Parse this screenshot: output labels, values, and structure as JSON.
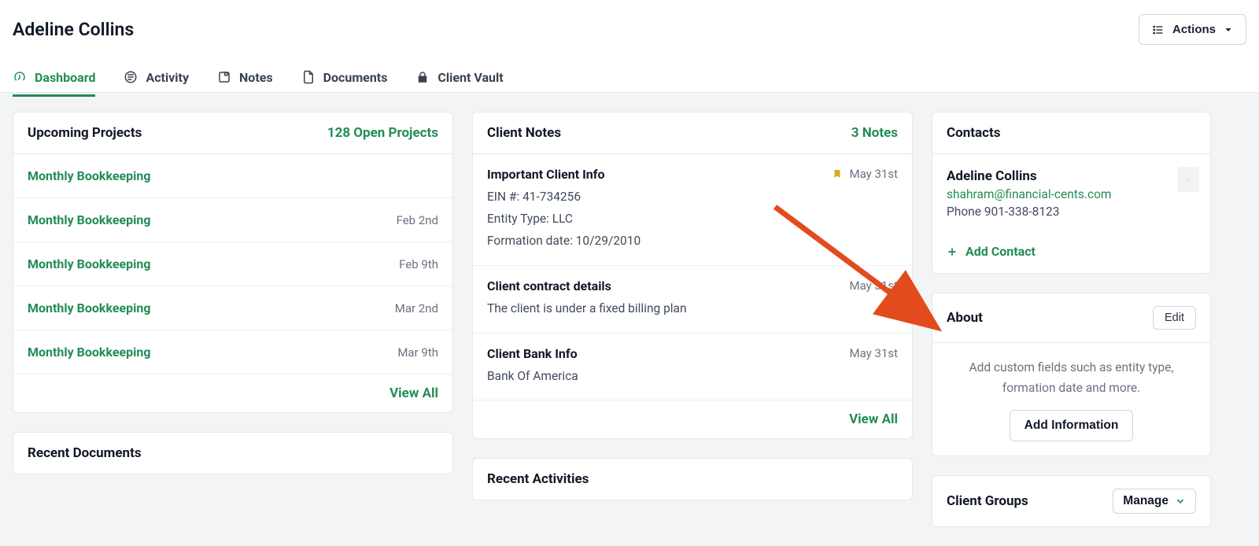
{
  "header": {
    "title": "Adeline Collins",
    "actions_label": "Actions"
  },
  "tabs": {
    "dashboard": "Dashboard",
    "activity": "Activity",
    "notes": "Notes",
    "documents": "Documents",
    "client_vault": "Client Vault"
  },
  "projects": {
    "title": "Upcoming Projects",
    "open_label": "128 Open Projects",
    "rows": [
      {
        "name": "Monthly Bookkeeping",
        "date": ""
      },
      {
        "name": "Monthly Bookkeeping",
        "date": "Feb 2nd"
      },
      {
        "name": "Monthly Bookkeeping",
        "date": "Feb 9th"
      },
      {
        "name": "Monthly Bookkeeping",
        "date": "Mar 2nd"
      },
      {
        "name": "Monthly Bookkeeping",
        "date": "Mar 9th"
      }
    ],
    "view_all": "View All"
  },
  "notes": {
    "title": "Client Notes",
    "count_label": "3 Notes",
    "items": [
      {
        "title": "Important Client Info",
        "bookmarked": true,
        "date": "May 31st",
        "lines": [
          "EIN #: 41-734256",
          "Entity Type: LLC",
          "Formation date: 10/29/2010"
        ]
      },
      {
        "title": "Client contract details",
        "bookmarked": false,
        "date": "May 31st",
        "lines": [
          "The client is under a fixed billing plan"
        ]
      },
      {
        "title": "Client Bank Info",
        "bookmarked": false,
        "date": "May 31st",
        "lines": [
          "Bank Of America"
        ]
      }
    ],
    "view_all": "View All"
  },
  "contacts": {
    "title": "Contacts",
    "name": "Adeline Collins",
    "email": "shahram@financial-cents.com",
    "phone": "Phone 901-338-8123",
    "add_contact": "Add Contact"
  },
  "about": {
    "title": "About",
    "edit": "Edit",
    "description": "Add custom fields such as entity type, formation date and more.",
    "add_info": "Add Information"
  },
  "client_groups": {
    "title": "Client Groups",
    "manage": "Manage"
  },
  "bottom": {
    "recent_documents": "Recent Documents",
    "recent_activities": "Recent Activities"
  },
  "arrow": {
    "color": "#e24b1b"
  }
}
